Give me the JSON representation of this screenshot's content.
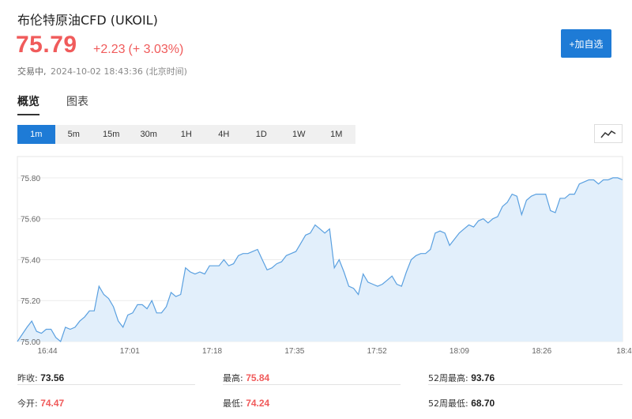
{
  "header": {
    "title": "布伦特原油CFD  (UKOIL)",
    "price": "75.79",
    "change": "+2.23",
    "change_pct": "(+ 3.03%)",
    "status": "交易中,",
    "timestamp": "2024-10-02 18:43:36 (北京时间)",
    "add_button": "+加自选"
  },
  "tabs": [
    {
      "label": "概览",
      "active": true
    },
    {
      "label": "图表",
      "active": false
    }
  ],
  "intervals": [
    {
      "label": "1m",
      "active": true
    },
    {
      "label": "5m",
      "active": false
    },
    {
      "label": "15m",
      "active": false
    },
    {
      "label": "30m",
      "active": false
    },
    {
      "label": "1H",
      "active": false
    },
    {
      "label": "4H",
      "active": false
    },
    {
      "label": "1D",
      "active": false
    },
    {
      "label": "1W",
      "active": false
    },
    {
      "label": "1M",
      "active": false
    }
  ],
  "chart_type_icon": "line-chart-icon",
  "colors": {
    "up": "#f05b5b",
    "accent": "#1e7bd6",
    "line": "#5aa0e0",
    "fill": "#e2effb"
  },
  "chart_data": {
    "type": "area",
    "x_ticks": [
      "16:44",
      "17:01",
      "17:18",
      "17:35",
      "17:52",
      "18:09",
      "18:26",
      "18:4"
    ],
    "y_ticks": [
      "75.00",
      "75.20",
      "75.40",
      "75.60",
      "75.80"
    ],
    "ylim": [
      75.0,
      75.85
    ],
    "grid": true,
    "x_start": "16:43",
    "x_end": "18:43",
    "series": [
      {
        "values": [
          [
            0,
            75.0
          ],
          [
            2,
            75.07
          ],
          [
            3,
            75.1
          ],
          [
            4,
            75.05
          ],
          [
            5,
            75.04
          ],
          [
            6,
            75.06
          ],
          [
            7,
            75.06
          ],
          [
            8,
            75.02
          ],
          [
            9,
            75.0
          ],
          [
            10,
            75.07
          ],
          [
            11,
            75.06
          ],
          [
            12,
            75.07
          ],
          [
            13,
            75.1
          ],
          [
            14,
            75.12
          ],
          [
            15,
            75.15
          ],
          [
            16,
            75.15
          ],
          [
            17,
            75.27
          ],
          [
            18,
            75.23
          ],
          [
            19,
            75.21
          ],
          [
            20,
            75.17
          ],
          [
            21,
            75.1
          ],
          [
            22,
            75.07
          ],
          [
            23,
            75.13
          ],
          [
            24,
            75.14
          ],
          [
            25,
            75.18
          ],
          [
            26,
            75.18
          ],
          [
            27,
            75.16
          ],
          [
            28,
            75.2
          ],
          [
            29,
            75.14
          ],
          [
            30,
            75.14
          ],
          [
            31,
            75.17
          ],
          [
            32,
            75.24
          ],
          [
            33,
            75.22
          ],
          [
            34,
            75.23
          ],
          [
            35,
            75.36
          ],
          [
            36,
            75.34
          ],
          [
            37,
            75.33
          ],
          [
            38,
            75.34
          ],
          [
            39,
            75.33
          ],
          [
            40,
            75.37
          ],
          [
            41,
            75.37
          ],
          [
            42,
            75.37
          ],
          [
            43,
            75.4
          ],
          [
            44,
            75.37
          ],
          [
            45,
            75.38
          ],
          [
            46,
            75.42
          ],
          [
            47,
            75.43
          ],
          [
            48,
            75.43
          ],
          [
            49,
            75.44
          ],
          [
            50,
            75.45
          ],
          [
            51,
            75.4
          ],
          [
            52,
            75.35
          ],
          [
            53,
            75.36
          ],
          [
            54,
            75.38
          ],
          [
            55,
            75.39
          ],
          [
            56,
            75.42
          ],
          [
            57,
            75.43
          ],
          [
            58,
            75.44
          ],
          [
            59,
            75.48
          ],
          [
            60,
            75.52
          ],
          [
            61,
            75.53
          ],
          [
            62,
            75.57
          ],
          [
            63,
            75.55
          ],
          [
            64,
            75.53
          ],
          [
            65,
            75.55
          ],
          [
            66,
            75.36
          ],
          [
            67,
            75.4
          ],
          [
            68,
            75.34
          ],
          [
            69,
            75.27
          ],
          [
            70,
            75.26
          ],
          [
            71,
            75.23
          ],
          [
            72,
            75.33
          ],
          [
            73,
            75.29
          ],
          [
            74,
            75.28
          ],
          [
            75,
            75.27
          ],
          [
            76,
            75.28
          ],
          [
            77,
            75.3
          ],
          [
            78,
            75.32
          ],
          [
            79,
            75.28
          ],
          [
            80,
            75.27
          ],
          [
            81,
            75.34
          ],
          [
            82,
            75.4
          ],
          [
            83,
            75.42
          ],
          [
            84,
            75.43
          ],
          [
            85,
            75.43
          ],
          [
            86,
            75.45
          ],
          [
            87,
            75.53
          ],
          [
            88,
            75.54
          ],
          [
            89,
            75.53
          ],
          [
            90,
            75.47
          ],
          [
            91,
            75.5
          ],
          [
            92,
            75.53
          ],
          [
            93,
            75.55
          ],
          [
            94,
            75.57
          ],
          [
            95,
            75.56
          ],
          [
            96,
            75.59
          ],
          [
            97,
            75.6
          ],
          [
            98,
            75.58
          ],
          [
            99,
            75.6
          ],
          [
            100,
            75.61
          ],
          [
            101,
            75.66
          ],
          [
            102,
            75.68
          ],
          [
            103,
            75.72
          ],
          [
            104,
            75.71
          ],
          [
            105,
            75.62
          ],
          [
            106,
            75.69
          ],
          [
            107,
            75.71
          ],
          [
            108,
            75.72
          ],
          [
            109,
            75.72
          ],
          [
            110,
            75.72
          ],
          [
            111,
            75.64
          ],
          [
            112,
            75.63
          ],
          [
            113,
            75.7
          ],
          [
            114,
            75.7
          ],
          [
            115,
            75.72
          ],
          [
            116,
            75.72
          ],
          [
            117,
            75.77
          ],
          [
            118,
            75.78
          ],
          [
            119,
            75.79
          ],
          [
            120,
            75.79
          ],
          [
            121,
            75.77
          ],
          [
            122,
            75.79
          ],
          [
            123,
            75.79
          ],
          [
            124,
            75.8
          ],
          [
            125,
            75.8
          ],
          [
            126,
            75.79
          ]
        ]
      }
    ]
  },
  "stats": {
    "prev_close": {
      "label": "昨收: ",
      "value": "73.56"
    },
    "high": {
      "label": "最高: ",
      "value": "75.84"
    },
    "high_52w": {
      "label": "52周最高: ",
      "value": "93.76"
    },
    "open": {
      "label": "今开: ",
      "value": "74.47"
    },
    "low": {
      "label": "最低: ",
      "value": "74.24"
    },
    "low_52w": {
      "label": "52周最低: ",
      "value": "68.70"
    }
  }
}
